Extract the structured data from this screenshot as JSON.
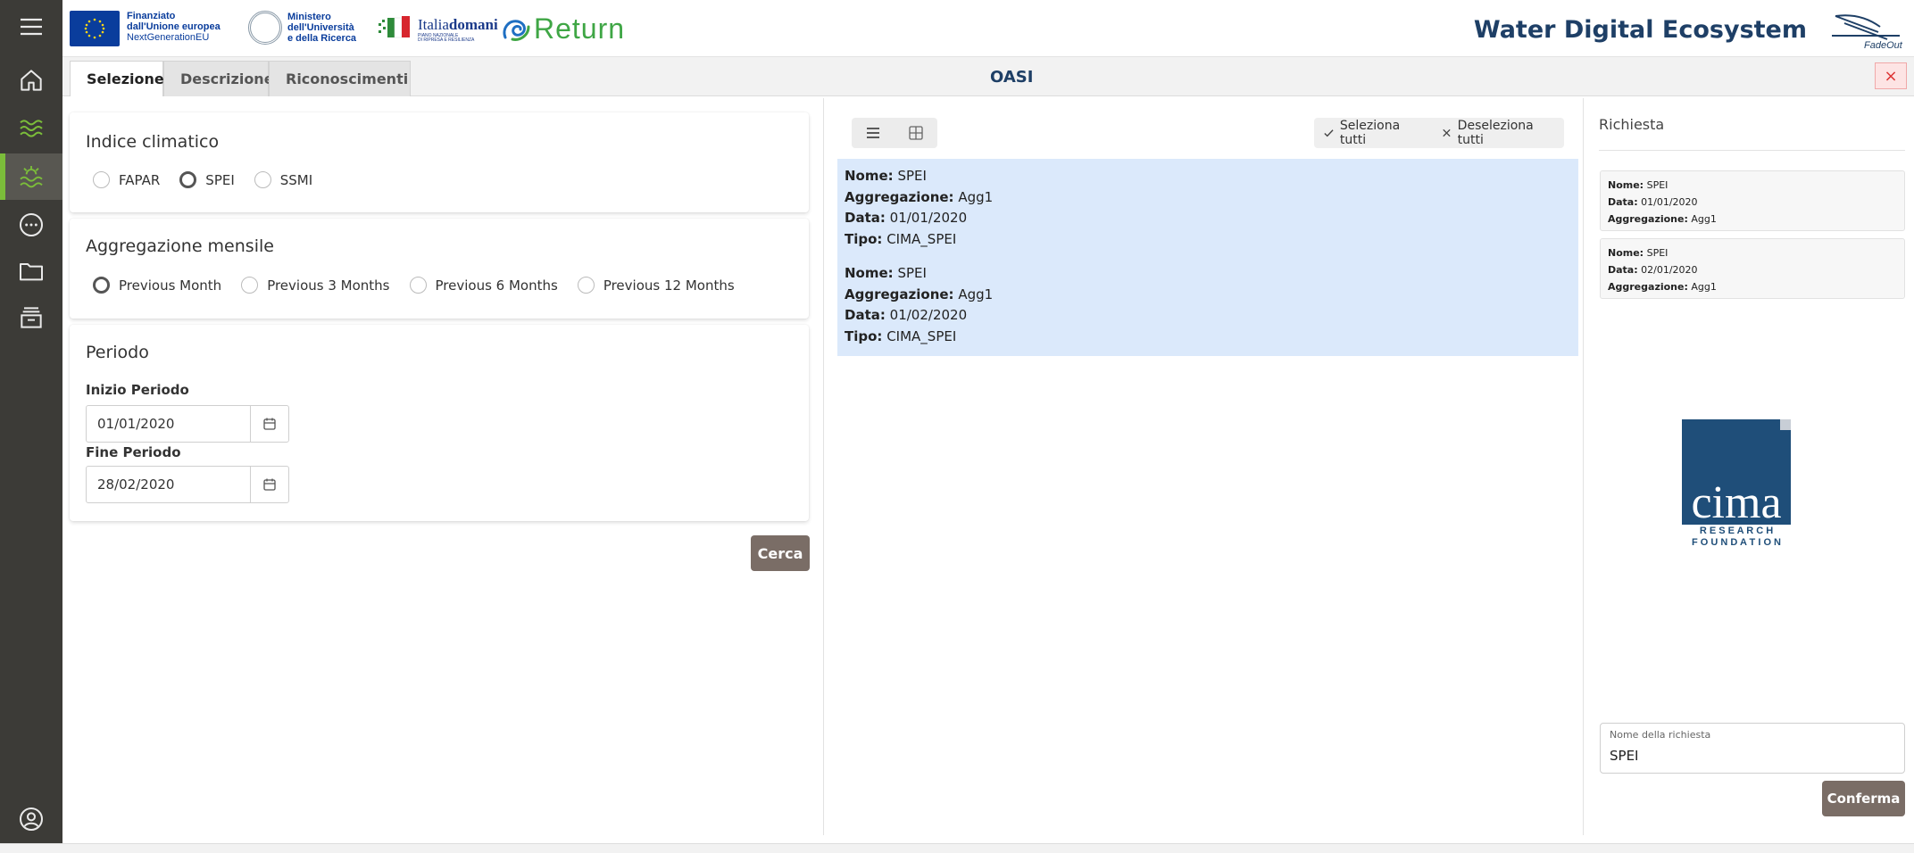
{
  "header": {
    "eu_logo_lines": [
      "Finanziato",
      "dall'Unione europea",
      "NextGenerationEU"
    ],
    "ministry_lines": [
      "Ministero",
      "dell'Università",
      "e della Ricerca"
    ],
    "italiadomani_a": "Italia",
    "italiadomani_b": "domani",
    "italiadomani_sub_lines": [
      "PIANO NAZIONALE",
      "DI RIPRESA E RESILIENZA"
    ],
    "return_logo": "Return",
    "app_title": "Water Digital Ecosystem",
    "fadeout_logo": "FadeOut"
  },
  "tabs": [
    {
      "label": "Selezione",
      "active": true
    },
    {
      "label": "Descrizione",
      "active": false
    },
    {
      "label": "Riconoscimenti",
      "active": false
    }
  ],
  "page_title": "OASI",
  "close_label": "×",
  "indice": {
    "title": "Indice climatico",
    "options": [
      {
        "label": "FAPAR",
        "checked": false
      },
      {
        "label": "SPEI",
        "checked": true
      },
      {
        "label": "SSMI",
        "checked": false
      }
    ]
  },
  "aggregazione": {
    "title": "Aggregazione mensile",
    "options": [
      {
        "label": "Previous Month",
        "checked": true
      },
      {
        "label": "Previous 3 Months",
        "checked": false
      },
      {
        "label": "Previous 6 Months",
        "checked": false
      },
      {
        "label": "Previous 12 Months",
        "checked": false
      }
    ]
  },
  "periodo": {
    "title": "Periodo",
    "start_label": "Inizio Periodo",
    "start_value": "01/01/2020",
    "end_label": "Fine Periodo",
    "end_value": "28/02/2020"
  },
  "cerca_label": "Cerca",
  "results_toolbar": {
    "select_all": "Seleziona tutti",
    "deselect_all": "Deseleziona tutti"
  },
  "field_labels": {
    "nome": "Nome:",
    "aggregazione": "Aggregazione:",
    "data": "Data:",
    "tipo": "Tipo:"
  },
  "results": [
    {
      "nome": "SPEI",
      "aggregazione": "Agg1",
      "data": "01/01/2020",
      "tipo": "CIMA_SPEI"
    },
    {
      "nome": "SPEI",
      "aggregazione": "Agg1",
      "data": "01/02/2020",
      "tipo": "CIMA_SPEI"
    }
  ],
  "richiesta": {
    "title": "Richiesta",
    "items": [
      {
        "nome": "SPEI",
        "data": "01/01/2020",
        "aggregazione": "Agg1"
      },
      {
        "nome": "SPEI",
        "data": "02/01/2020",
        "aggregazione": "Agg1"
      }
    ],
    "name_label": "Nome della richiesta",
    "name_value": "SPEI",
    "confirm_label": "Conferma"
  },
  "cima": {
    "wordmark": "cima",
    "line1": "R E S E A R C H",
    "line2": "F O U N D A T I O N"
  },
  "sidebar_icons": [
    "menu-icon",
    "home-icon",
    "waves-icon",
    "drought-icon",
    "more-icon",
    "folder-icon",
    "archive-icon",
    "user-icon"
  ],
  "colors": {
    "sidebar_bg": "#3c3b37",
    "accent_green": "#7bbd3a",
    "title_blue": "#1e3f66",
    "button_brown": "#7a6d66",
    "selected_bg": "#dbe9fb",
    "cima_blue": "#1f4e79"
  }
}
